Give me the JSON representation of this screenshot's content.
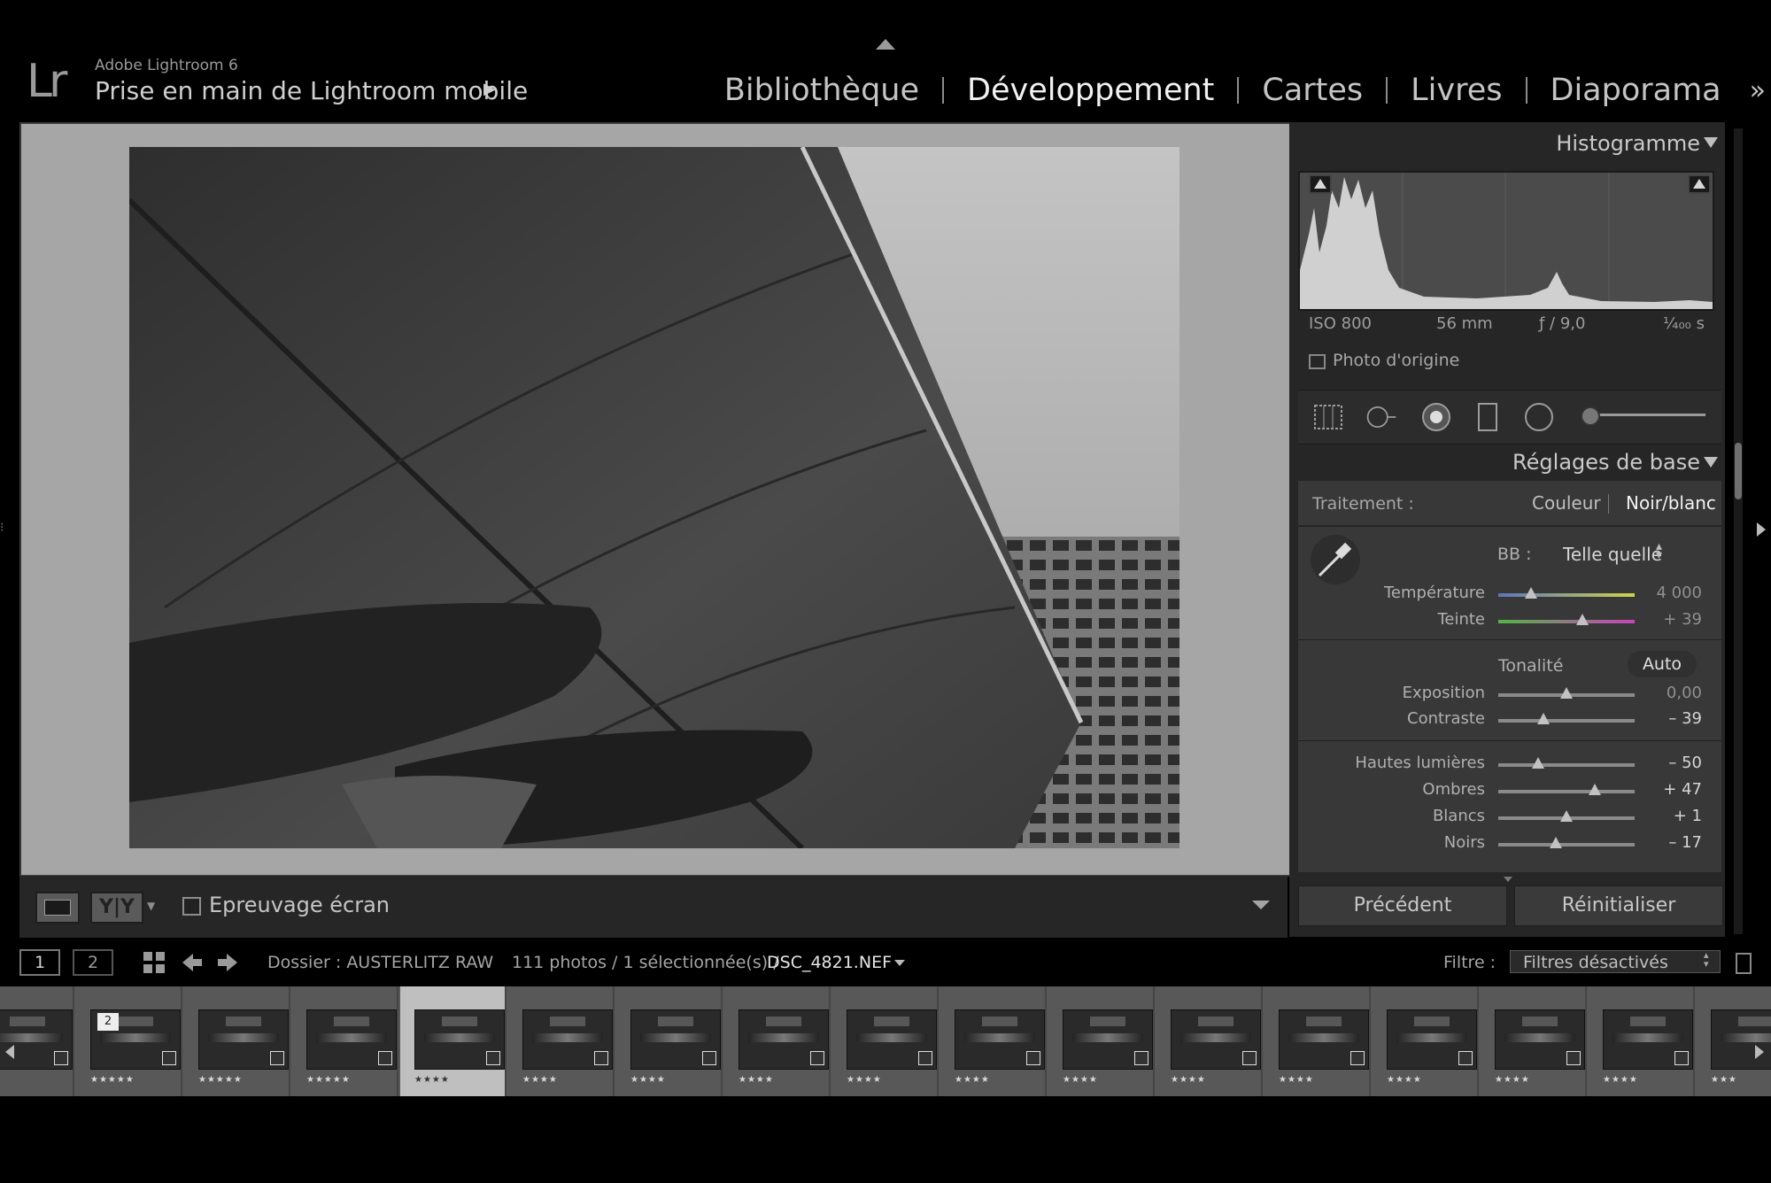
{
  "header": {
    "logo": "Lr",
    "app_name": "Adobe Lightroom 6",
    "catalog": "Prise en main de Lightroom mobile",
    "modules": [
      "Bibliothèque",
      "Développement",
      "Cartes",
      "Livres",
      "Diaporama"
    ],
    "active_module": "Développement",
    "more": "»"
  },
  "toolbar": {
    "proof_label": "Epreuvage écran",
    "compare_label": "Y|Y"
  },
  "histogram": {
    "title": "Histogramme",
    "iso": "ISO 800",
    "focal": "56 mm",
    "aperture": "ƒ / 9,0",
    "shutter": "¹⁄₄₀₀ s",
    "original_label": "Photo d'origine"
  },
  "basic": {
    "title": "Réglages de base",
    "treatment_label": "Traitement :",
    "treatment_color": "Couleur",
    "treatment_bw": "Noir/blanc",
    "wb_label": "BB :",
    "wb_value": "Telle quelle",
    "tone_label": "Tonalité",
    "auto_label": "Auto",
    "sliders": [
      {
        "label": "Température",
        "value": "4 000",
        "position": 0.24
      },
      {
        "label": "Teinte",
        "value": "+ 39",
        "position": 0.62
      },
      {
        "label": "Exposition",
        "value": "0,00",
        "position": 0.5
      },
      {
        "label": "Contraste",
        "value": "– 39",
        "position": 0.33
      },
      {
        "label": "Hautes lumières",
        "value": "– 50",
        "position": 0.29
      },
      {
        "label": "Ombres",
        "value": "+ 47",
        "position": 0.71
      },
      {
        "label": "Blancs",
        "value": "+ 1",
        "position": 0.5
      },
      {
        "label": "Noirs",
        "value": "– 17",
        "position": 0.42
      }
    ]
  },
  "buttons": {
    "previous": "Précédent",
    "reset": "Réinitialiser"
  },
  "filmbar": {
    "page1": "1",
    "page2": "2",
    "folder": "Dossier : AUSTERLITZ RAW",
    "count": "111 photos / 1 sélectionnée(s) /",
    "filename": "DSC_4821.NEF",
    "filter_label": "Filtre :",
    "filter_value": "Filtres désactivés"
  },
  "filmstrip": {
    "selected_index": 4,
    "stack_count": "2",
    "ratings": [
      "★",
      "★★★★★",
      "★★★★★",
      "★★★★★",
      "★★★★",
      "★★★★",
      "★★★★",
      "★★★★",
      "★★★★",
      "★★★★",
      "★★★★",
      "★★★★",
      "★★★★",
      "★★★★",
      "★★★★",
      "★★★★",
      "★★★"
    ]
  }
}
